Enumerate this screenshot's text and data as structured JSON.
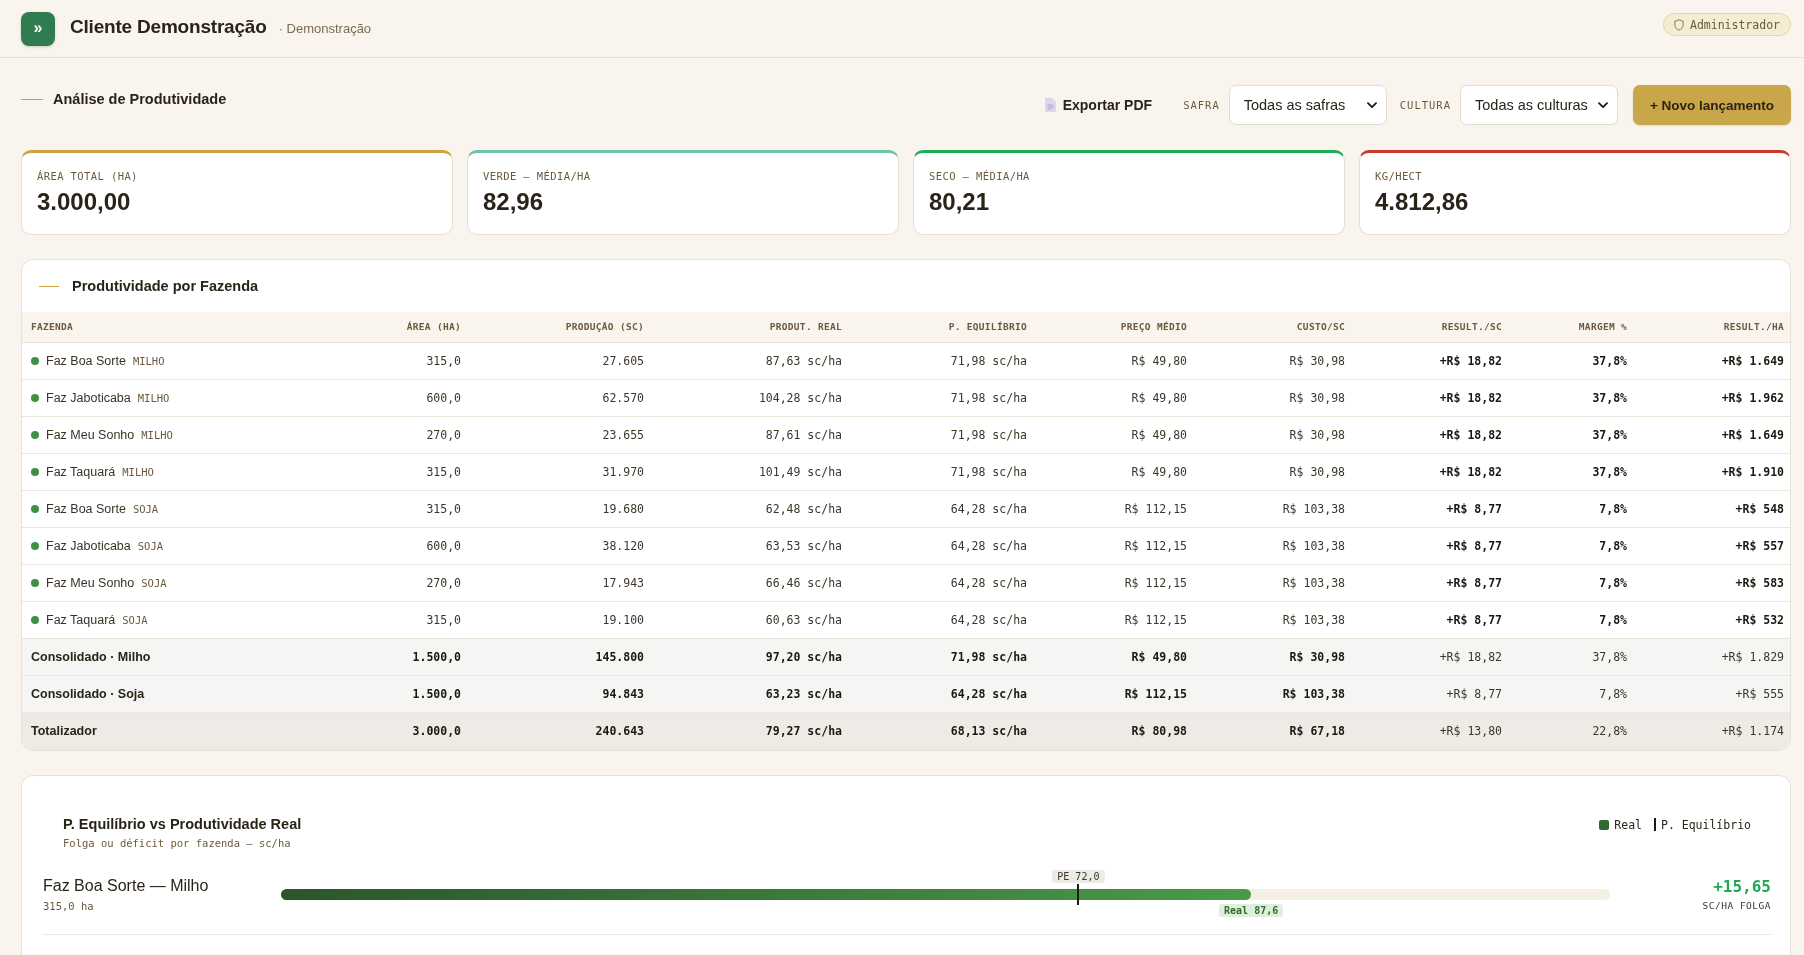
{
  "header": {
    "logo_glyph": "»",
    "title": "Cliente Demonstração",
    "subtitle": "· Demonstração",
    "role_badge": "Administrador"
  },
  "toolbar": {
    "title": "Análise de Produtividade",
    "export_button": "Exportar PDF",
    "filters": [
      {
        "label": "SAFRA",
        "value": "Todas as safras"
      },
      {
        "label": "CULTURA",
        "value": "Todas as culturas"
      }
    ],
    "primary_button": "+ Novo lançamento"
  },
  "kpis": [
    {
      "label": "ÁREA TOTAL (HA)",
      "value": "3.000,00",
      "color": "#c9a43f"
    },
    {
      "label": "VERDE — MÉDIA/HA",
      "value": "82,96",
      "color": "#6cc3a9"
    },
    {
      "label": "SECO — MÉDIA/HA",
      "value": "80,21",
      "color": "#22a95a"
    },
    {
      "label": "KG/HECT",
      "value": "4.812,86",
      "color": "#c63a2b"
    }
  ],
  "table": {
    "title": "Produtividade por Fazenda",
    "label_column": "FAZENDA",
    "columns": [
      "ÁREA (HA)",
      "PRODUÇÃO (SC)",
      "PRODUT. REAL",
      "P. EQUILÍBRIO",
      "PREÇO MÉDIO",
      "CUSTO/SC",
      "RESULT./SC",
      "MARGEM %",
      "RESULT./HA"
    ],
    "rows": [
      {
        "kind": "farm",
        "farm": "Faz Boa Sorte",
        "crop": "MILHO",
        "color": "#3f8f44",
        "cells": [
          "315,0",
          "27.605",
          "87,63 sc/ha",
          "71,98 sc/ha",
          "R$ 49,80",
          "R$ 30,98",
          "+R$ 18,82",
          "37,8%",
          "+R$ 1.649"
        ]
      },
      {
        "kind": "farm",
        "farm": "Faz Jaboticaba",
        "crop": "MILHO",
        "color": "#3f8f44",
        "cells": [
          "600,0",
          "62.570",
          "104,28 sc/ha",
          "71,98 sc/ha",
          "R$ 49,80",
          "R$ 30,98",
          "+R$ 18,82",
          "37,8%",
          "+R$ 1.962"
        ]
      },
      {
        "kind": "farm",
        "farm": "Faz Meu Sonho",
        "crop": "MILHO",
        "color": "#3f8f44",
        "cells": [
          "270,0",
          "23.655",
          "87,61 sc/ha",
          "71,98 sc/ha",
          "R$ 49,80",
          "R$ 30,98",
          "+R$ 18,82",
          "37,8%",
          "+R$ 1.649"
        ]
      },
      {
        "kind": "farm",
        "farm": "Faz Taquará",
        "crop": "MILHO",
        "color": "#3f8f44",
        "cells": [
          "315,0",
          "31.970",
          "101,49 sc/ha",
          "71,98 sc/ha",
          "R$ 49,80",
          "R$ 30,98",
          "+R$ 18,82",
          "37,8%",
          "+R$ 1.910"
        ]
      },
      {
        "kind": "farm",
        "farm": "Faz Boa Sorte",
        "crop": "SOJA",
        "color": "#3f8f44",
        "cells": [
          "315,0",
          "19.680",
          "62,48 sc/ha",
          "64,28 sc/ha",
          "R$ 112,15",
          "R$ 103,38",
          "+R$ 8,77",
          "7,8%",
          "+R$ 548"
        ]
      },
      {
        "kind": "farm",
        "farm": "Faz Jaboticaba",
        "crop": "SOJA",
        "color": "#3f8f44",
        "cells": [
          "600,0",
          "38.120",
          "63,53 sc/ha",
          "64,28 sc/ha",
          "R$ 112,15",
          "R$ 103,38",
          "+R$ 8,77",
          "7,8%",
          "+R$ 557"
        ]
      },
      {
        "kind": "farm",
        "farm": "Faz Meu Sonho",
        "crop": "SOJA",
        "color": "#3f8f44",
        "cells": [
          "270,0",
          "17.943",
          "66,46 sc/ha",
          "64,28 sc/ha",
          "R$ 112,15",
          "R$ 103,38",
          "+R$ 8,77",
          "7,8%",
          "+R$ 583"
        ]
      },
      {
        "kind": "farm",
        "farm": "Faz Taquará",
        "crop": "SOJA",
        "color": "#3f8f44",
        "cells": [
          "315,0",
          "19.100",
          "60,63 sc/ha",
          "64,28 sc/ha",
          "R$ 112,15",
          "R$ 103,38",
          "+R$ 8,77",
          "7,8%",
          "+R$ 532"
        ]
      },
      {
        "kind": "subtotal",
        "farm": "Consolidado · Milho",
        "cells": [
          "1.500,0",
          "145.800",
          "97,20 sc/ha",
          "71,98 sc/ha",
          "R$ 49,80",
          "R$ 30,98",
          "+R$ 18,82",
          "37,8%",
          "+R$ 1.829"
        ]
      },
      {
        "kind": "subtotal",
        "farm": "Consolidado · Soja",
        "cells": [
          "1.500,0",
          "94.843",
          "63,23 sc/ha",
          "64,28 sc/ha",
          "R$ 112,15",
          "R$ 103,38",
          "+R$ 8,77",
          "7,8%",
          "+R$ 555"
        ]
      },
      {
        "kind": "total",
        "farm": "Totalizador",
        "cells": [
          "3.000,0",
          "240.643",
          "79,27 sc/ha",
          "68,13 sc/ha",
          "R$ 80,98",
          "R$ 67,18",
          "+R$ 13,80",
          "22,8%",
          "+R$ 1.174"
        ]
      }
    ]
  },
  "chart": {
    "title": "P. Equilíbrio vs Produtividade Real",
    "subtitle": "Folga ou déficit por fazenda — sc/ha",
    "legend": [
      {
        "kind": "swatch",
        "label": "Real"
      },
      {
        "kind": "marker",
        "label": "P. Equilíbrio"
      }
    ],
    "rows": [
      {
        "name": "Faz Boa Sorte — Milho",
        "area": "315,0 ha",
        "real": {
          "label": "Real 87,6",
          "level": 0.73
        },
        "breakeven": {
          "label": "PE 72,0",
          "level": 0.6
        },
        "delta": "+15,65",
        "surplus": true,
        "delta_label": "SC/HA FOLGA"
      }
    ]
  }
}
